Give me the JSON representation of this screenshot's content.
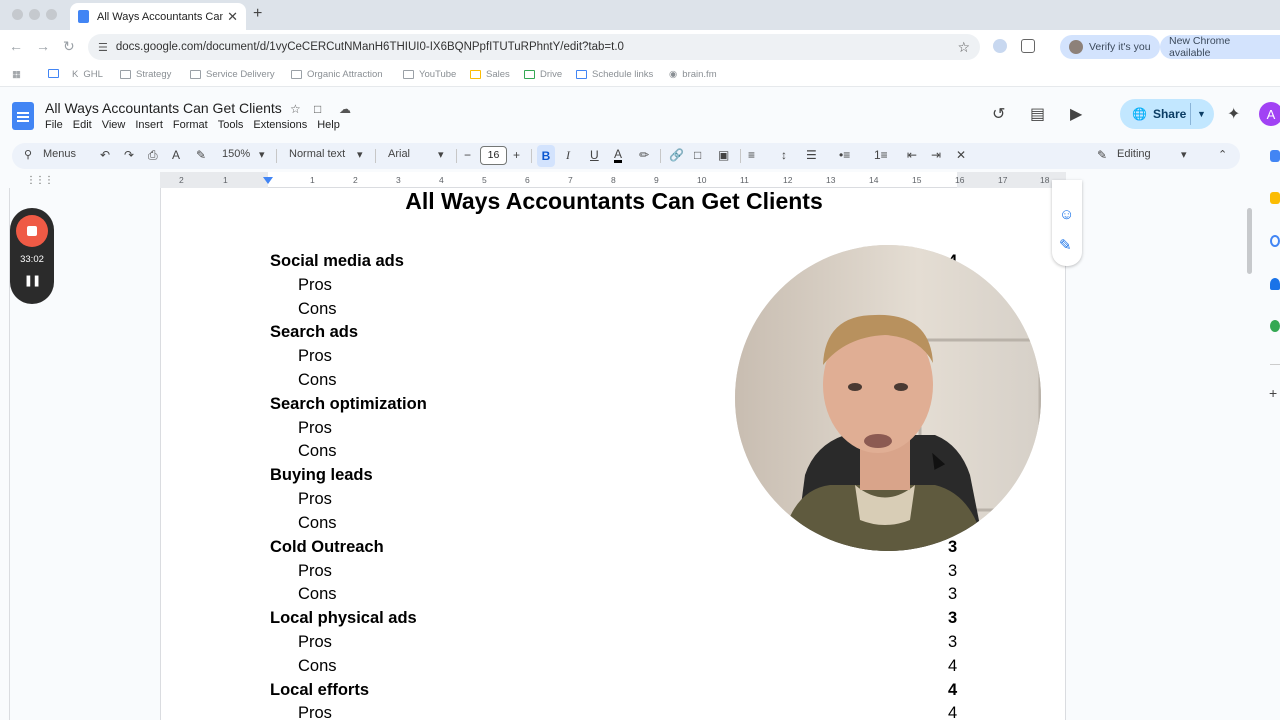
{
  "browser": {
    "tab_title": "All Ways Accountants Can Ge",
    "tab_close": "✕",
    "new_tab": "+",
    "url": "docs.google.com/document/d/1vyCeCERCutNManH6THIUI0-IX6BQNPpfITUTuRPhntY/edit?tab=t.0",
    "verify_pill": "Verify it's you",
    "update_pill": "New Chrome available",
    "bookmarks": [
      "GHL",
      "Strategy",
      "Service Delivery",
      "Organic Attraction",
      "YouTube",
      "Sales",
      "Drive",
      "Schedule links",
      "brain.fm"
    ]
  },
  "docs": {
    "title": "All Ways Accountants Can Get Clients",
    "menu": [
      "File",
      "Edit",
      "View",
      "Insert",
      "Format",
      "Tools",
      "Extensions",
      "Help"
    ],
    "share_label": "Share",
    "avatar_letter": "A",
    "toolbar": {
      "search": "Menus",
      "zoom": "150%",
      "style": "Normal text",
      "font": "Arial",
      "font_size": "16",
      "mode": "Editing"
    },
    "ruler_numbers": [
      "2",
      "1",
      "1",
      "2",
      "3",
      "4",
      "5",
      "6",
      "7",
      "8",
      "9",
      "10",
      "11",
      "12",
      "13",
      "14",
      "15",
      "16",
      "17",
      "18"
    ],
    "heading": "All Ways Accountants Can Get Clients",
    "sections": [
      {
        "name": "Social media ads",
        "score": "4",
        "pros": "",
        "cons": ""
      },
      {
        "name": "Search ads",
        "score": "",
        "pros": "",
        "cons": ""
      },
      {
        "name": "Search optimization",
        "score": "",
        "pros": "",
        "cons": ""
      },
      {
        "name": "Buying leads",
        "score": "",
        "pros": "",
        "cons": ""
      },
      {
        "name": "Cold Outreach",
        "score": "3",
        "pros": "3",
        "cons": "3"
      },
      {
        "name": "Local physical ads",
        "score": "3",
        "pros": "3",
        "cons": "4"
      },
      {
        "name": "Local efforts",
        "score": "4",
        "pros": "4",
        "cons": ""
      }
    ],
    "pros_label": "Pros",
    "cons_label": "Cons"
  },
  "recorder": {
    "time": "33:02"
  }
}
